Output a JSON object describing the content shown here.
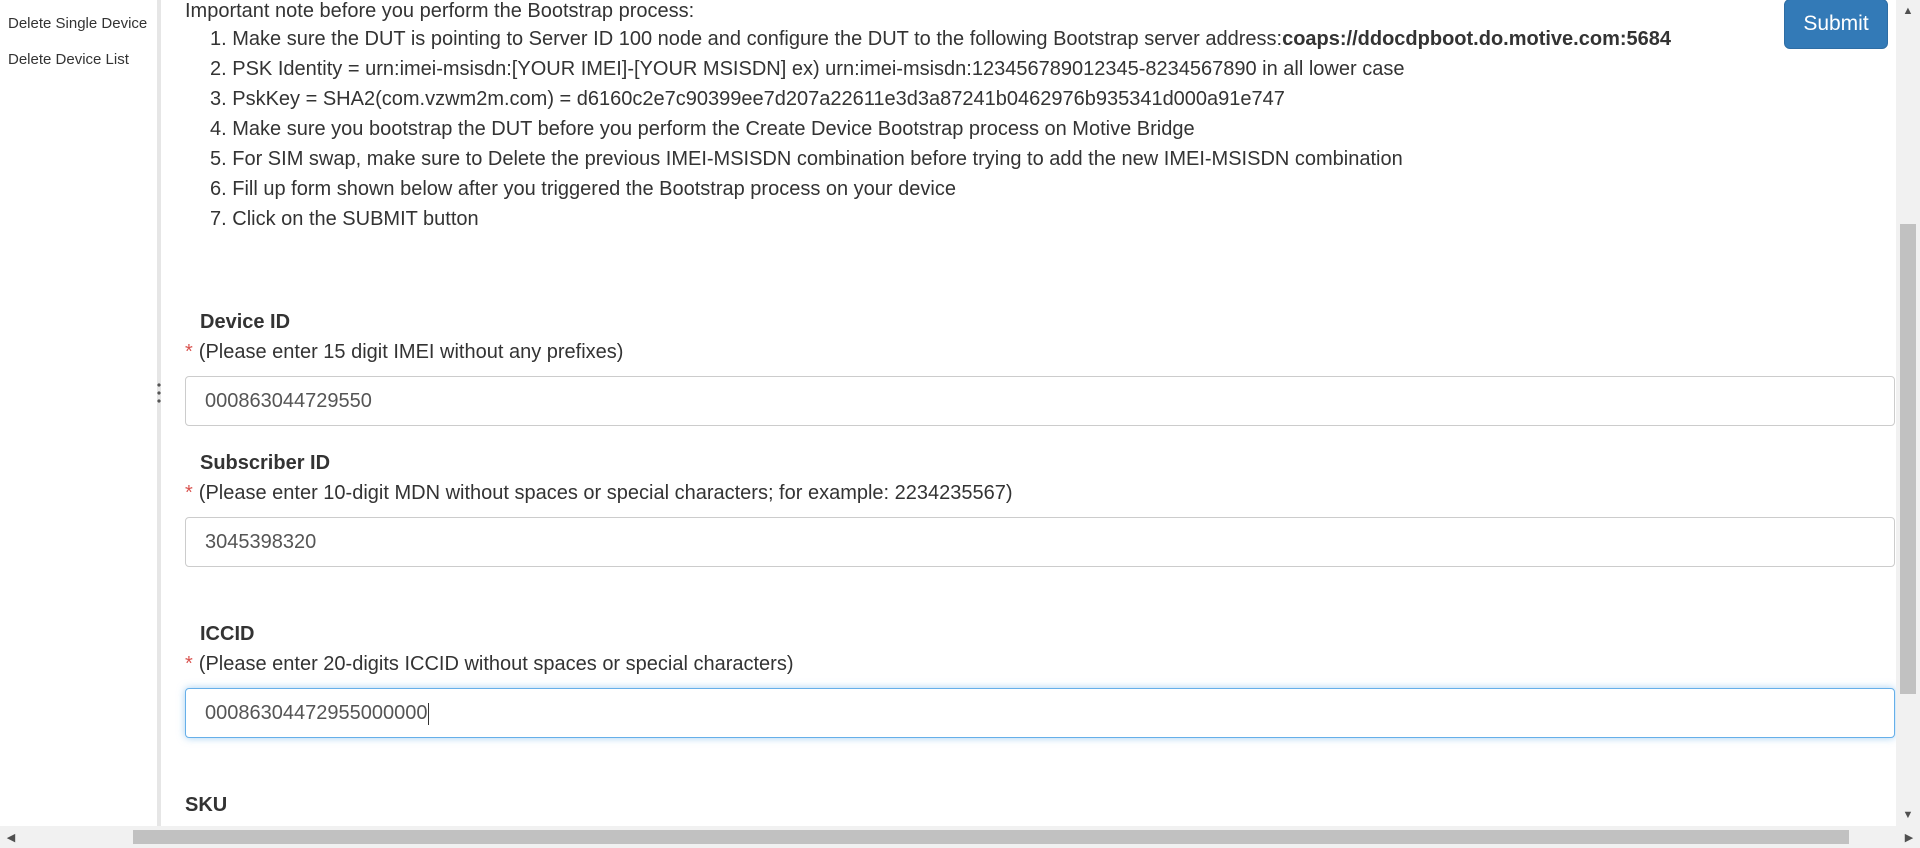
{
  "sidebar": {
    "items": [
      {
        "label": "Delete Single Device"
      },
      {
        "label": "Delete Device List"
      }
    ]
  },
  "main": {
    "intro": "Important note before you perform the Bootstrap process:",
    "steps": [
      {
        "num": "1.",
        "text": "Make sure the DUT is pointing to Server ID 100 node and configure the DUT to the following Bootstrap server address:",
        "bold": "coaps://ddocdpboot.do.motive.com:5684"
      },
      {
        "num": "2.",
        "text": "PSK Identity = urn:imei-msisdn:[YOUR IMEI]-[YOUR MSISDN] ex) urn:imei-msisdn:123456789012345-8234567890 in all lower case",
        "bold": ""
      },
      {
        "num": "3.",
        "text": "PskKey = SHA2(com.vzwm2m.com) = d6160c2e7c90399ee7d207a22611e3d3a87241b0462976b935341d000a91e747",
        "bold": ""
      },
      {
        "num": "4.",
        "text": "Make sure you bootstrap the DUT before you perform the Create Device Bootstrap process on Motive Bridge",
        "bold": ""
      },
      {
        "num": "5.",
        "text": "For SIM swap, make sure to Delete the previous IMEI-MSISDN combination before trying to add the new IMEI-MSISDN combination",
        "bold": ""
      },
      {
        "num": "6.",
        "text": "Fill up form shown below after you triggered the Bootstrap process on your device",
        "bold": ""
      },
      {
        "num": "7.",
        "text": "Click on the SUBMIT button",
        "bold": ""
      }
    ],
    "submit_label": "Submit"
  },
  "form": {
    "required_mark": "*",
    "device_id": {
      "label": "Device ID",
      "hint": "(Please enter 15 digit IMEI without any prefixes)",
      "value": "000863044729550"
    },
    "subscriber_id": {
      "label": "Subscriber ID",
      "hint": "(Please enter 10-digit MDN without spaces or special characters; for example: 2234235567)",
      "value": "3045398320"
    },
    "iccid": {
      "label": "ICCID",
      "hint": "(Please enter 20-digits ICCID without spaces or special characters)",
      "value": "00086304472955000000"
    },
    "sku": {
      "label": "SKU"
    }
  },
  "scrollbars": {
    "up_arrow": "▲",
    "down_arrow": "▼",
    "left_arrow": "◀",
    "right_arrow": "▶"
  },
  "colors": {
    "accent": "#337ab7",
    "required": "#d9534f",
    "focus": "#66afe9"
  }
}
